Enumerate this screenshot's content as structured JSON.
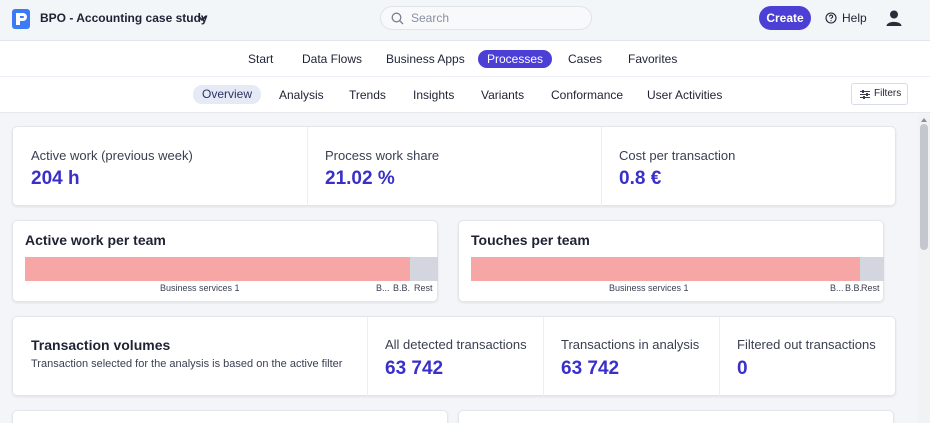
{
  "header": {
    "project_title": "BPO - Accounting case study",
    "search_placeholder": "Search",
    "create_label": "Create",
    "help_label": "Help"
  },
  "main_nav": [
    "Start",
    "Data Flows",
    "Business Apps",
    "Processes",
    "Cases",
    "Favorites"
  ],
  "main_nav_active": "Processes",
  "sub_nav": [
    "Overview",
    "Analysis",
    "Trends",
    "Insights",
    "Variants",
    "Conformance",
    "User Activities"
  ],
  "sub_nav_active": "Overview",
  "filters_label": "Filters",
  "kpis": [
    {
      "label": "Active work (previous week)",
      "value": "204 h"
    },
    {
      "label": "Process work share",
      "value": "21.02 %"
    },
    {
      "label": "Cost per transaction",
      "value": "0.8 €"
    }
  ],
  "team_charts": [
    {
      "title": "Active work per team",
      "segments": [
        {
          "label": "Business services 1",
          "share": 0.932,
          "color": "#f7a6a6"
        },
        {
          "label": "B...",
          "share": 0.0,
          "color": "#d3d6de"
        },
        {
          "label": "B.B.",
          "share": 0.0,
          "color": "#d3d6de"
        },
        {
          "label": "Rest",
          "share": 0.068,
          "color": "#d3d6de"
        }
      ]
    },
    {
      "title": "Touches per team",
      "segments": [
        {
          "label": "Business services 1",
          "share": 0.942,
          "color": "#f7a6a6"
        },
        {
          "label": "B...",
          "share": 0.0,
          "color": "#d3d6de"
        },
        {
          "label": "B.B.",
          "share": 0.0,
          "color": "#d3d6de"
        },
        {
          "label": "Rest",
          "share": 0.058,
          "color": "#d3d6de"
        }
      ]
    }
  ],
  "transaction_volumes": {
    "title": "Transaction volumes",
    "subtitle": "Transaction selected for the analysis is based on the active filter",
    "metrics": [
      {
        "label": "All detected transactions",
        "value": "63 742"
      },
      {
        "label": "Transactions in analysis",
        "value": "63 742"
      },
      {
        "label": "Filtered out transactions",
        "value": "0"
      }
    ]
  },
  "colors": {
    "accent": "#4b3fd6",
    "value_text": "#3a30c8",
    "bar_primary": "#f7a6a6",
    "bar_rest": "#d3d6de"
  }
}
